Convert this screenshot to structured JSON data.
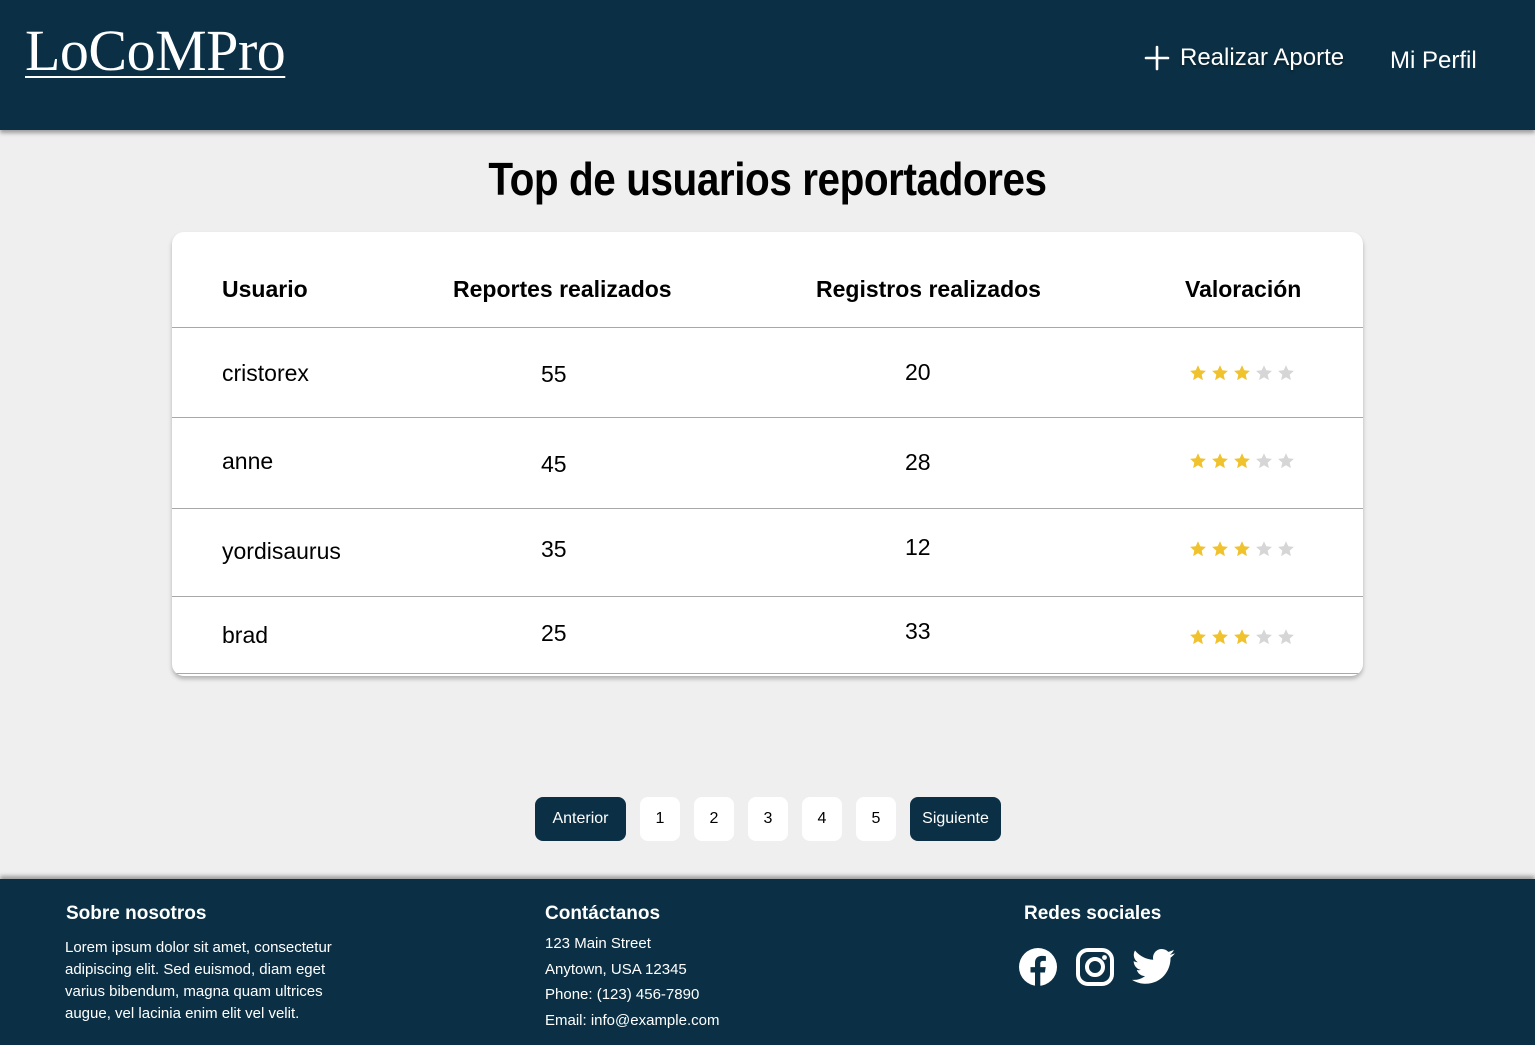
{
  "header": {
    "logo": "LoCoMPro",
    "nav": {
      "add_contribution": "Realizar Aporte",
      "profile": "Mi Perfil"
    }
  },
  "page": {
    "title": "Top de usuarios reportadores"
  },
  "table": {
    "columns": [
      "Usuario",
      "Reportes realizados",
      "Registros realizados",
      "Valoración"
    ],
    "rows": [
      {
        "user": "cristorex",
        "reports": "55",
        "records": "20",
        "rating": 3,
        "rating_max": 5
      },
      {
        "user": "anne",
        "reports": "45",
        "records": "28",
        "rating": 3,
        "rating_max": 5
      },
      {
        "user": "yordisaurus",
        "reports": "35",
        "records": "12",
        "rating": 3,
        "rating_max": 5
      },
      {
        "user": "brad",
        "reports": "25",
        "records": "33",
        "rating": 3,
        "rating_max": 5
      }
    ]
  },
  "pagination": {
    "prev": "Anterior",
    "pages": [
      "1",
      "2",
      "3",
      "4",
      "5"
    ],
    "next": "Siguiente"
  },
  "footer": {
    "about": {
      "title": "Sobre nosotros",
      "lines": [
        "Lorem ipsum dolor sit amet, consectetur",
        "adipiscing elit. Sed euismod, diam eget",
        "varius bibendum, magna quam ultrices",
        "augue, vel lacinia enim elit vel velit."
      ]
    },
    "contact": {
      "title": "Contáctanos",
      "lines": [
        "123 Main Street",
        "Anytown, USA 12345",
        "Phone: (123) 456-7890",
        "Email: info@example.com"
      ]
    },
    "social": {
      "title": "Redes sociales",
      "icons": [
        "facebook-icon",
        "instagram-icon",
        "twitter-icon"
      ]
    }
  },
  "colors": {
    "brand": "#0b3045",
    "background": "#efefef",
    "star_filled": "#f0c22e",
    "star_empty": "#d6d6d6"
  }
}
